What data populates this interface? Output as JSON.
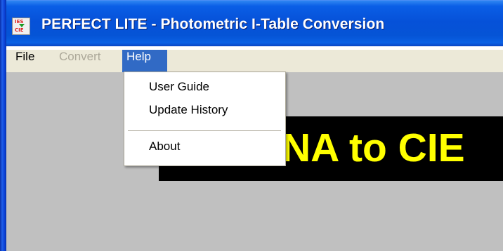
{
  "window": {
    "title": "PERFECT LITE - Photometric I-Table Conversion",
    "icon_name": "ies-to-cie-app-icon",
    "icon_top_text": "IES",
    "icon_bottom_text": "CIE"
  },
  "menubar": {
    "items": [
      {
        "label": "File",
        "state": "enabled"
      },
      {
        "label": "Convert",
        "state": "disabled"
      },
      {
        "label": "Help",
        "state": "open"
      }
    ]
  },
  "help_menu": {
    "items": [
      {
        "label": "User Guide"
      },
      {
        "label": "Update History"
      },
      {
        "label": "About"
      }
    ]
  },
  "banner": {
    "text": "NA to CIE",
    "text_color": "#ffff00",
    "background_color": "#000000"
  },
  "colors": {
    "titlebar": "#0554d6",
    "menu_highlight": "#316ac5",
    "client_background": "#c0c0c0"
  }
}
